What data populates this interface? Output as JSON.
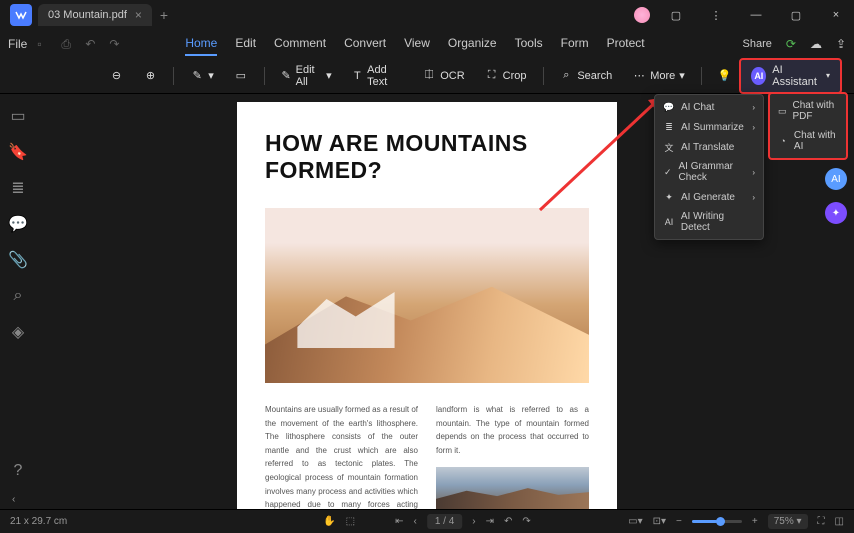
{
  "titlebar": {
    "tab_name": "03 Mountain.pdf"
  },
  "menubar": {
    "file": "File",
    "tabs": [
      "Home",
      "Edit",
      "Comment",
      "Convert",
      "View",
      "Organize",
      "Tools",
      "Form",
      "Protect"
    ],
    "active_tab": 0,
    "share": "Share"
  },
  "toolbar": {
    "edit_all": "Edit All",
    "add_text": "Add Text",
    "ocr": "OCR",
    "crop": "Crop",
    "search": "Search",
    "more": "More",
    "ai_assistant": "AI Assistant"
  },
  "dropdown": {
    "items": [
      {
        "label": "AI Chat",
        "has_submenu": true
      },
      {
        "label": "AI Summarize",
        "has_submenu": true
      },
      {
        "label": "AI Translate",
        "has_submenu": false
      },
      {
        "label": "AI Grammar Check",
        "has_submenu": true
      },
      {
        "label": "AI Generate",
        "has_submenu": true
      },
      {
        "label": "AI Writing Detect",
        "has_submenu": false
      }
    ]
  },
  "submenu": {
    "items": [
      "Chat with PDF",
      "Chat with AI"
    ]
  },
  "document": {
    "title": "HOW ARE MOUNTAINS FORMED?",
    "col1": "Mountains are usually formed as a result of the movement of the earth's lithosphere. The lithosphere consists of the outer mantle and the crust which are also referred to as tectonic plates. The geological process of mountain formation involves many process and activities which happened due to many forces acting together or in isolation. The",
    "col2": "landform is what is referred to as a mountain. The type of mountain formed depends on the process that occurred to form it."
  },
  "statusbar": {
    "dimensions": "21 x 29.7 cm",
    "page": "1 / 4",
    "zoom": "75%"
  }
}
